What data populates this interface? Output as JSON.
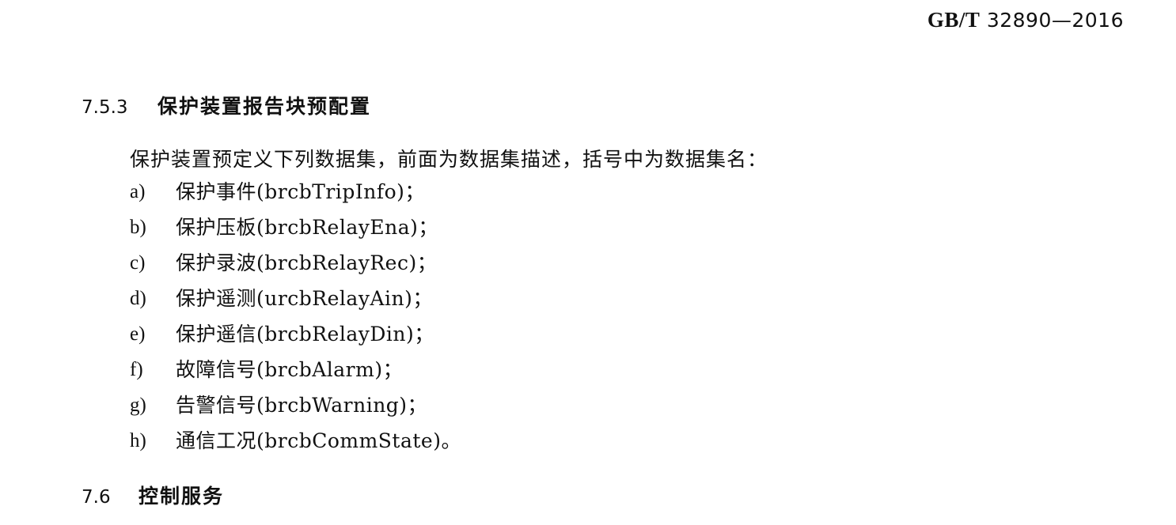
{
  "header": {
    "standard_prefix": "GB/T",
    "standard_number": "32890—2016"
  },
  "sections": {
    "s753": {
      "number": "7.5.3",
      "title": "保护装置报告块预配置"
    },
    "s76": {
      "number": "7.6",
      "title": "控制服务"
    }
  },
  "body": {
    "intro": "保护装置预定义下列数据集，前面为数据集描述，括号中为数据集名：",
    "items": [
      {
        "marker": "a)",
        "text": "保护事件(brcbTripInfo)；"
      },
      {
        "marker": "b)",
        "text": "保护压板(brcbRelayEna)；"
      },
      {
        "marker": "c)",
        "text": "保护录波(brcbRelayRec)；"
      },
      {
        "marker": "d)",
        "text": "保护遥测(urcbRelayAin)；"
      },
      {
        "marker": "e)",
        "text": "保护遥信(brcbRelayDin)；"
      },
      {
        "marker": "f)",
        "text": "故障信号(brcbAlarm)；"
      },
      {
        "marker": "g)",
        "text": "告警信号(brcbWarning)；"
      },
      {
        "marker": "h)",
        "text": "通信工况(brcbCommState)。"
      }
    ]
  }
}
